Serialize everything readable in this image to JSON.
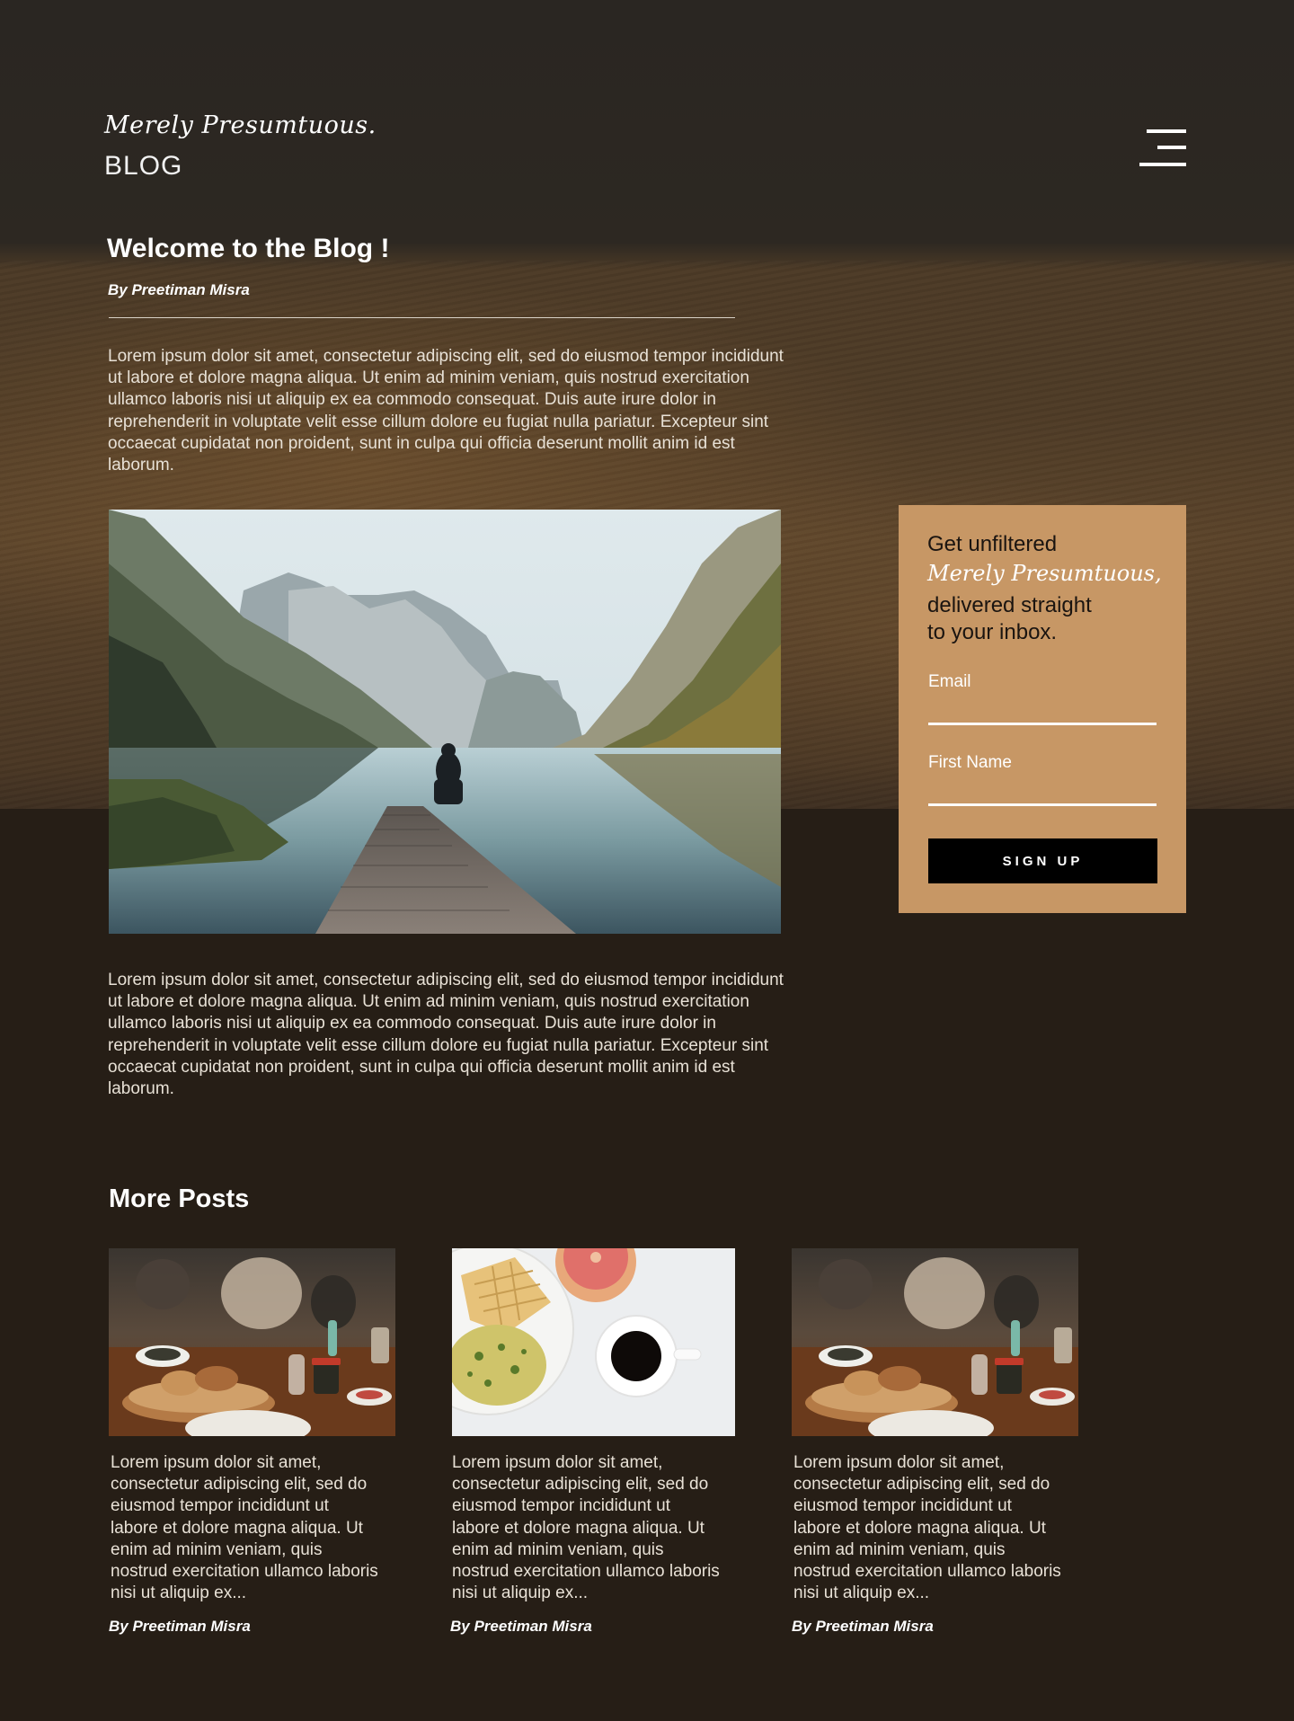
{
  "header": {
    "logo_script": "Merely Presumtuous.",
    "logo_text": "BLOG",
    "menu_icon": "hamburger-menu-icon"
  },
  "post": {
    "title": "Welcome to the Blog !",
    "author": "By Preetiman Misra",
    "paragraph1": "Lorem ipsum dolor sit amet, consectetur adipiscing elit, sed do eiusmod tempor incididunt ut labore et dolore magna aliqua. Ut enim ad minim veniam, quis nostrud exercitation ullamco laboris nisi ut aliquip ex ea commodo consequat. Duis aute irure dolor in reprehenderit in voluptate velit esse cillum dolore eu fugiat nulla pariatur. Excepteur sint occaecat cupidatat non proident, sunt in culpa qui officia deserunt mollit anim id est laborum.",
    "paragraph2": "Lorem ipsum dolor sit amet, consectetur adipiscing elit, sed do eiusmod tempor incididunt ut labore et dolore magna aliqua. Ut enim ad minim veniam, quis nostrud exercitation ullamco laboris nisi ut aliquip ex ea commodo consequat. Duis aute irure dolor in reprehenderit in voluptate velit esse cillum dolore eu fugiat nulla pariatur. Excepteur sint occaecat cupidatat non proident, sunt in culpa qui officia deserunt mollit anim id est laborum."
  },
  "signup": {
    "line1": "Get unfiltered",
    "line2": "Merely Presumtuous,",
    "line3": "delivered straight",
    "line4": "to your inbox.",
    "email_label": "Email",
    "first_name_label": "First Name",
    "button_label": "SIGN UP",
    "panel_color": "#c79765"
  },
  "more_posts": {
    "title": "More Posts",
    "cards": [
      {
        "excerpt": "Lorem ipsum dolor sit amet, consectetur adipiscing elit, sed do eiusmod tempor incididunt ut labore et dolore magna aliqua. Ut enim ad minim veniam, quis nostrud exercitation ullamco laboris nisi ut aliquip ex...",
        "author": "By Preetiman Misra"
      },
      {
        "excerpt": "Lorem ipsum dolor sit amet, consectetur adipiscing elit, sed do eiusmod tempor incididunt ut labore et dolore magna aliqua. Ut enim ad minim veniam, quis nostrud exercitation ullamco laboris nisi ut aliquip ex...",
        "author": "By Preetiman Misra"
      },
      {
        "excerpt": "Lorem ipsum dolor sit amet, consectetur adipiscing elit, sed do eiusmod tempor incididunt ut labore et dolore magna aliqua. Ut enim ad minim veniam, quis nostrud exercitation ullamco laboris nisi ut aliquip ex...",
        "author": "By Preetiman Misra"
      }
    ]
  }
}
